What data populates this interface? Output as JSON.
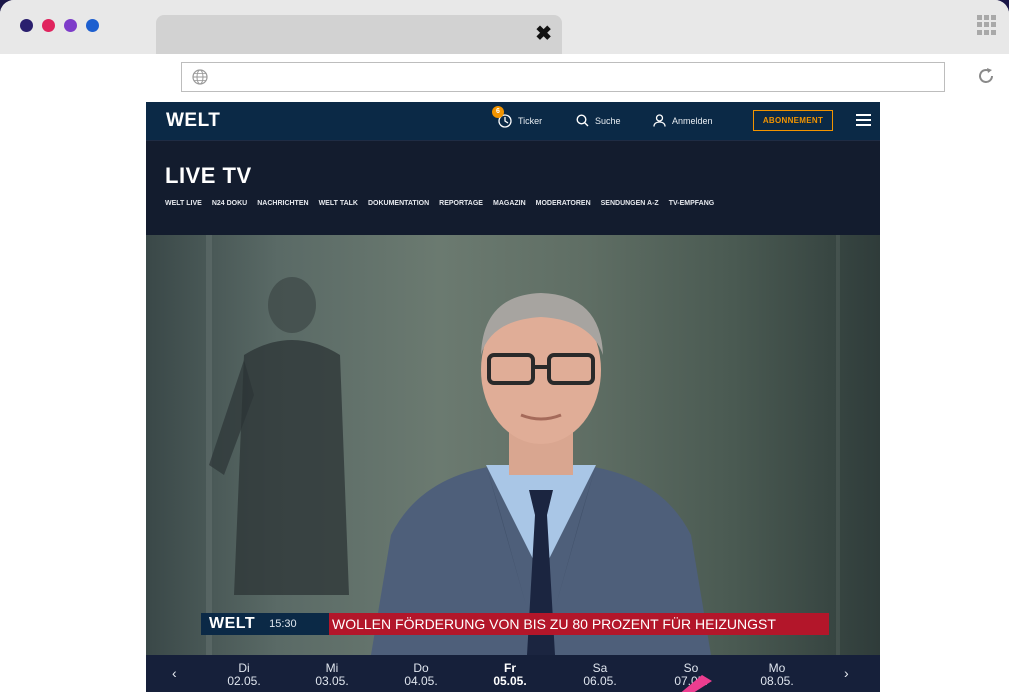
{
  "colors": {
    "desktop_bg": "#1b1748",
    "dot_colors": [
      "#2a1f6e",
      "#e0245e",
      "#7d3cc9",
      "#1d5fcf"
    ],
    "brand_navy": "#0b2946",
    "accent_orange": "#f29400",
    "lower_third_red": "#b3162a"
  },
  "browser": {
    "tab_close_icon": "close-icon",
    "url": ""
  },
  "site": {
    "logo": "WELT",
    "nav": {
      "ticker_badge": "6",
      "ticker": "Ticker",
      "search": "Suche",
      "login": "Anmelden",
      "subscribe": "ABONNEMENT"
    },
    "live_title": "LIVE TV",
    "subnav": [
      "WELT LIVE",
      "N24 DOKU",
      "NACHRICHTEN",
      "WELT TALK",
      "DOKUMENTATION",
      "REPORTAGE",
      "MAGAZIN",
      "MODERATOREN",
      "SENDUNGEN A-Z",
      "TV-EMPFANG"
    ]
  },
  "video": {
    "lower_third_logo": "WELT",
    "lower_third_time": "15:30",
    "headline": "WOLLEN FÖRDERUNG VON BIS ZU 80 PROZENT FÜR HEIZUNGST"
  },
  "schedule": {
    "prev": "‹",
    "next": "›",
    "days": [
      {
        "name": "Di",
        "date": "02.05."
      },
      {
        "name": "Mi",
        "date": "03.05."
      },
      {
        "name": "Do",
        "date": "04.05."
      },
      {
        "name": "Fr",
        "date": "05.05."
      },
      {
        "name": "Sa",
        "date": "06.05."
      },
      {
        "name": "So",
        "date": "07.05."
      },
      {
        "name": "Mo",
        "date": "08.05."
      }
    ]
  }
}
